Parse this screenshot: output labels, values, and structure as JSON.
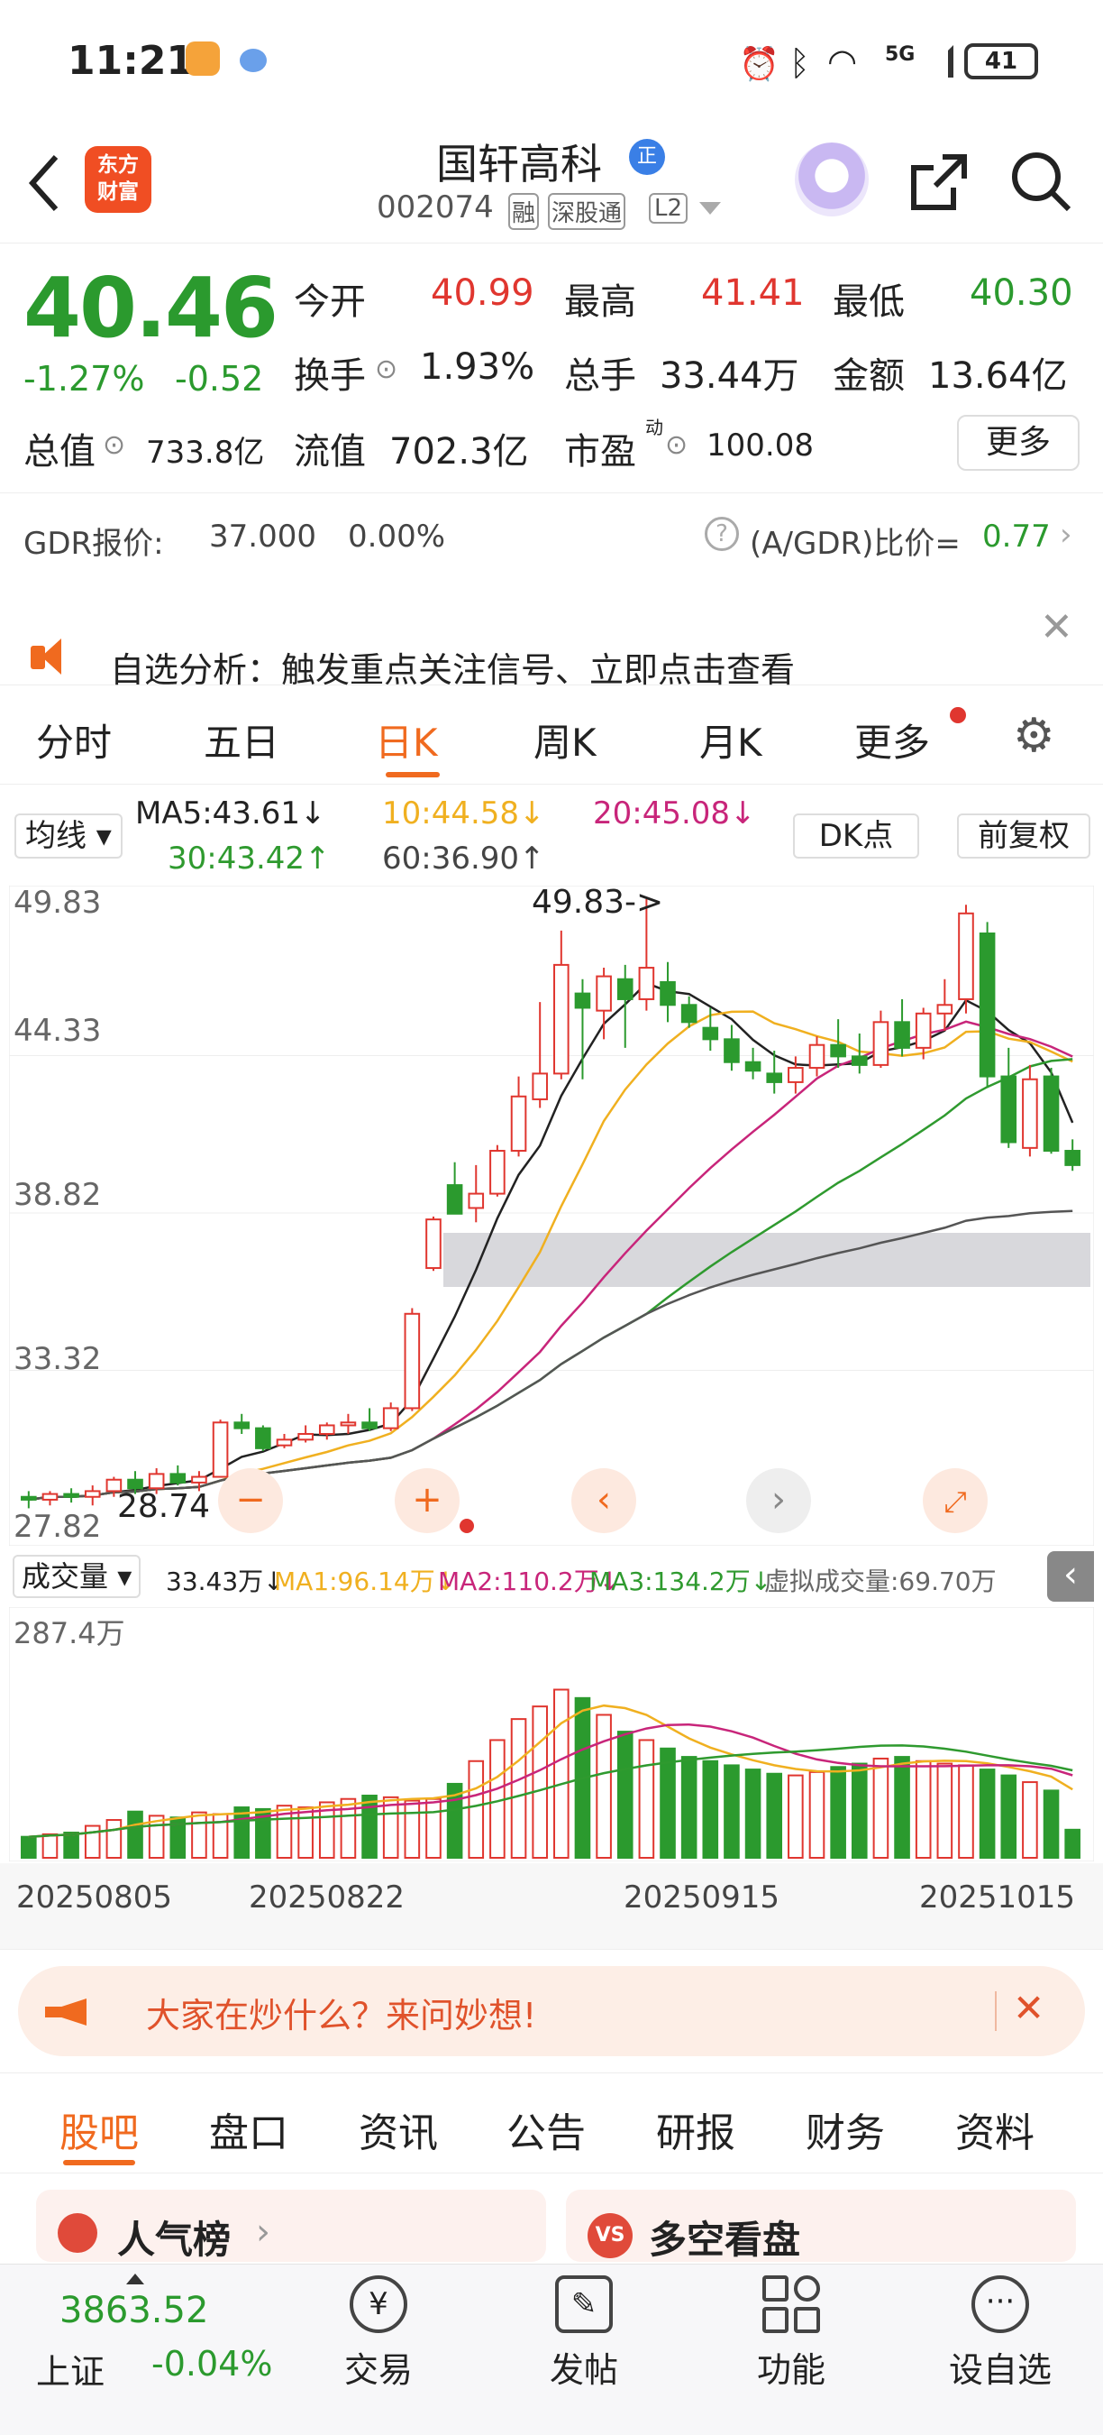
{
  "status_bar": {
    "time": "11:21",
    "network": "5G",
    "battery": "41"
  },
  "header": {
    "back_icon": "chevron-left-icon",
    "logo_text": "东方\n财富",
    "title": "国轩高科",
    "title_badge": "正",
    "code": "002074",
    "tags": [
      "融",
      "深股通",
      "L2"
    ],
    "share_icon": "share-icon",
    "search_icon": "search-icon"
  },
  "quote": {
    "price": "40.46",
    "change_pct": "-1.27%",
    "change": "-0.52",
    "fields": {
      "open_label": "今开",
      "open": "40.99",
      "high_label": "最高",
      "high": "41.41",
      "low_label": "最低",
      "low": "40.30",
      "turnover_label": "换手",
      "turnover": "1.93%",
      "volume_label": "总手",
      "volume": "33.44万",
      "amount_label": "金额",
      "amount": "13.64亿",
      "mktcap_label": "总值",
      "mktcap": "733.8亿",
      "float_label": "流值",
      "float": "702.3亿",
      "pe_label": "市盈",
      "pe_sup": "动",
      "pe": "100.08"
    },
    "more_button": "更多"
  },
  "gdr": {
    "label": "GDR报价:",
    "price": "37.000",
    "pct": "0.00%",
    "ratio_label": "(A/GDR)比价=",
    "ratio": "0.77"
  },
  "alert": {
    "text": "自选分析：触发重点关注信号、立即点击查看"
  },
  "chart_tabs": {
    "items": [
      "分时",
      "五日",
      "日K",
      "周K",
      "月K",
      "更多"
    ],
    "active": "日K"
  },
  "ma_bar": {
    "select": "均线",
    "ma5": "MA5:43.61",
    "ma10": "10:44.58",
    "ma20": "20:45.08",
    "ma30": "30:43.42",
    "ma60": "60:36.90",
    "dk_button": "DK点",
    "adjust_button": "前复权"
  },
  "kline_axis": {
    "labels": [
      "49.83",
      "44.33",
      "38.82",
      "33.32",
      "27.82"
    ],
    "high_note": "49.83->",
    "low_note": "28.74"
  },
  "vol_bar": {
    "select": "成交量",
    "vol": "33.43万",
    "ma1": "MA1:96.14万",
    "ma2": "MA2:110.2万",
    "ma3": "MA3:134.2万",
    "virtual": "虚拟成交量:69.70万",
    "axis_top": "287.4万"
  },
  "dates": [
    "20250805",
    "20250822",
    "20250915",
    "20251015"
  ],
  "promo": {
    "text": "大家在炒什么？来问妙想!"
  },
  "bottom_tabs": {
    "items": [
      "股吧",
      "盘口",
      "资讯",
      "公告",
      "研报",
      "财务",
      "资料"
    ],
    "active": "股吧"
  },
  "cards": {
    "left": "人气榜",
    "right": "多空看盘"
  },
  "bottom_nav": {
    "index_value": "3863.52",
    "index_name": "上证",
    "index_change": "-0.04%",
    "items": [
      "交易",
      "发帖",
      "功能",
      "设自选"
    ]
  },
  "colors": {
    "up": "#e0362f",
    "down": "#2b9a2e",
    "accent": "#f06a1f",
    "ma5": "#222222",
    "ma10": "#f0b020",
    "ma20": "#c8257a",
    "ma30": "#2f9a2f",
    "ma60": "#555555"
  },
  "chart_data": {
    "type": "candlestick",
    "ylim": [
      27.82,
      49.83
    ],
    "candles": [
      [
        28.9,
        29.1,
        28.5,
        28.8
      ],
      [
        28.8,
        29.1,
        28.6,
        29.0
      ],
      [
        29.0,
        29.2,
        28.7,
        28.9
      ],
      [
        28.9,
        29.3,
        28.6,
        29.1
      ],
      [
        29.1,
        29.6,
        28.9,
        29.5
      ],
      [
        29.5,
        29.8,
        29.0,
        29.2
      ],
      [
        29.2,
        29.9,
        29.0,
        29.7
      ],
      [
        29.7,
        30.0,
        29.3,
        29.4
      ],
      [
        29.4,
        29.8,
        29.1,
        29.6
      ],
      [
        29.6,
        31.6,
        29.6,
        31.5
      ],
      [
        31.5,
        31.8,
        31.1,
        31.3
      ],
      [
        31.3,
        31.4,
        30.5,
        30.6
      ],
      [
        30.7,
        31.1,
        30.6,
        30.9
      ],
      [
        30.9,
        31.4,
        30.8,
        31.1
      ],
      [
        31.1,
        31.5,
        30.9,
        31.4
      ],
      [
        31.4,
        31.8,
        31.1,
        31.5
      ],
      [
        31.5,
        32.0,
        31.2,
        31.3
      ],
      [
        31.3,
        32.2,
        31.2,
        32.0
      ],
      [
        32.0,
        35.5,
        31.9,
        35.3
      ],
      [
        36.9,
        38.7,
        36.8,
        38.6
      ],
      [
        39.8,
        40.6,
        38.9,
        38.8
      ],
      [
        39.0,
        40.5,
        38.5,
        39.5
      ],
      [
        39.5,
        41.2,
        39.4,
        41.0
      ],
      [
        41.0,
        43.6,
        40.8,
        42.9
      ],
      [
        42.8,
        46.2,
        42.5,
        43.7
      ],
      [
        43.7,
        48.7,
        43.5,
        47.5
      ],
      [
        46.5,
        47.0,
        43.5,
        46.0
      ],
      [
        45.9,
        47.4,
        44.9,
        47.1
      ],
      [
        47.0,
        47.5,
        44.6,
        46.3
      ],
      [
        46.3,
        49.8,
        45.9,
        47.4
      ],
      [
        46.9,
        47.6,
        45.5,
        46.1
      ],
      [
        46.1,
        46.4,
        45.3,
        45.5
      ],
      [
        45.3,
        46.0,
        44.5,
        44.9
      ],
      [
        44.9,
        45.4,
        43.8,
        44.1
      ],
      [
        44.1,
        44.6,
        43.5,
        43.8
      ],
      [
        43.7,
        44.5,
        43.0,
        43.4
      ],
      [
        43.4,
        44.3,
        43.0,
        43.9
      ],
      [
        43.9,
        45.0,
        43.6,
        44.7
      ],
      [
        44.7,
        45.6,
        43.9,
        44.3
      ],
      [
        44.3,
        45.1,
        43.7,
        44.0
      ],
      [
        44.0,
        45.9,
        43.9,
        45.5
      ],
      [
        45.5,
        46.3,
        44.3,
        44.6
      ],
      [
        44.6,
        46.0,
        44.2,
        45.8
      ],
      [
        45.8,
        47.0,
        45.2,
        46.1
      ],
      [
        46.3,
        49.6,
        45.8,
        49.3
      ],
      [
        48.6,
        49.0,
        43.2,
        43.6
      ],
      [
        43.6,
        44.6,
        41.1,
        41.3
      ],
      [
        41.1,
        44.0,
        40.8,
        43.5
      ],
      [
        43.6,
        43.9,
        40.9,
        41.0
      ],
      [
        41.0,
        41.4,
        40.3,
        40.5
      ]
    ],
    "volume_ylim": [
      0,
      287.4
    ],
    "volumes": [
      25,
      28,
      30,
      38,
      45,
      55,
      50,
      48,
      54,
      52,
      60,
      58,
      62,
      60,
      66,
      70,
      74,
      72,
      68,
      70,
      88,
      115,
      140,
      165,
      180,
      200,
      190,
      170,
      150,
      140,
      130,
      120,
      115,
      110,
      105,
      100,
      98,
      102,
      108,
      112,
      118,
      120,
      115,
      112,
      110,
      105,
      98,
      90,
      80,
      33.43
    ]
  }
}
